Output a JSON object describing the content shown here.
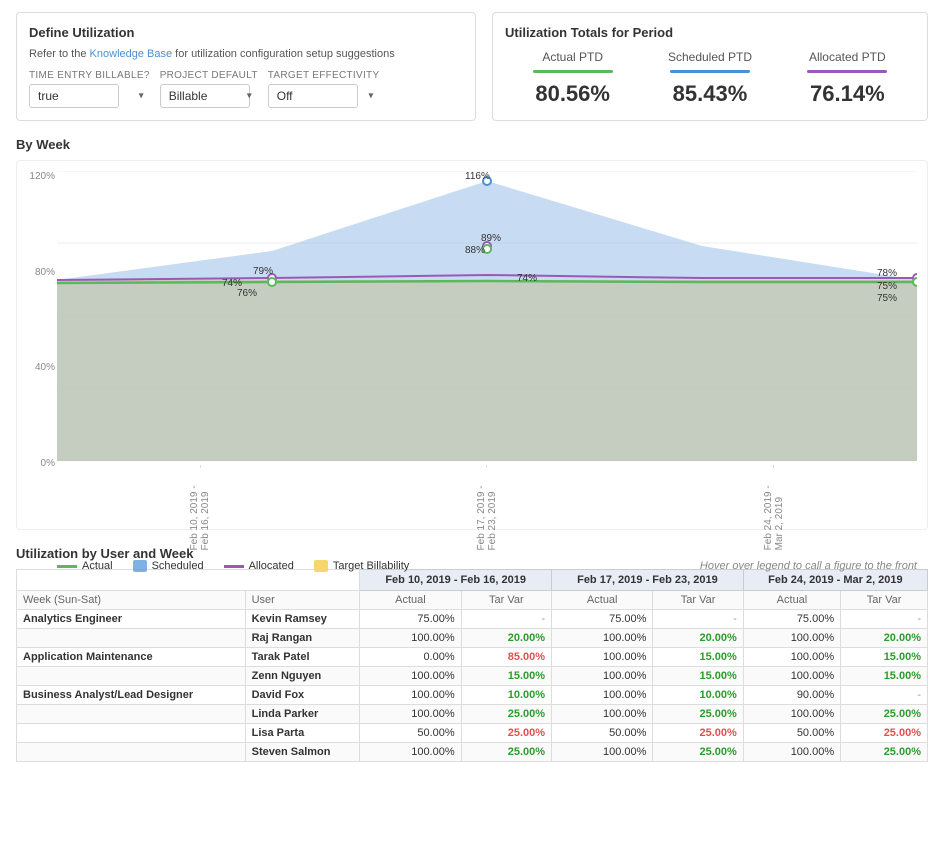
{
  "defineUtil": {
    "title": "Define Utilization",
    "note": "Refer to the",
    "noteLink": "Knowledge Base",
    "noteEnd": "for utilization configuration setup suggestions",
    "fields": {
      "timeEntryBillable": {
        "label": "TIME ENTRY BILLABLE?",
        "value": "true"
      },
      "projectDefault": {
        "label": "PROJECT DEFAULT",
        "value": "Billable"
      },
      "targetEffectivity": {
        "label": "TARGET EFFECTIVITY",
        "value": "Off"
      }
    }
  },
  "utilizationTotals": {
    "title": "Utilization Totals for Period",
    "items": [
      {
        "label": "Actual PTD",
        "value": "80.56%",
        "barClass": "green"
      },
      {
        "label": "Scheduled PTD",
        "value": "85.43%",
        "barClass": "blue"
      },
      {
        "label": "Allocated PTD",
        "value": "76.14%",
        "barClass": "purple"
      }
    ]
  },
  "byWeek": {
    "title": "By Week",
    "yLabels": [
      "120%",
      "80%",
      "40%",
      "0%"
    ],
    "xLabels": [
      "Feb 10, 2019 - Feb 16, 2019",
      "Feb 17, 2019 - Feb 23, 2019",
      "Feb 24, 2019 - Mar 2, 2019"
    ],
    "legend": [
      {
        "color": "#5cb85c",
        "label": "Actual",
        "type": "line"
      },
      {
        "color": "#4a90d9",
        "label": "Scheduled",
        "type": "area"
      },
      {
        "color": "#9b59b6",
        "label": "Allocated",
        "type": "line"
      },
      {
        "color": "#f5d76e",
        "label": "Target Billability",
        "type": "area"
      }
    ],
    "legendHint": "Hover over legend to call a figure to the front"
  },
  "userWeek": {
    "title": "Utilization by User and Week",
    "weekHeaders": [
      "Feb 10, 2019 - Feb 16, 2019",
      "Feb 17, 2019 - Feb 23, 2019",
      "Feb 24, 2019 - Mar 2, 2019"
    ],
    "subHeaders": [
      "Week (Sun-Sat)",
      "User",
      "Actual",
      "Tar Var",
      "Actual",
      "Tar Var",
      "Actual",
      "Tar Var"
    ],
    "rows": [
      {
        "role": "Analytics Engineer",
        "user": "Kevin Ramsey",
        "w1a": "75.00%",
        "w1t": "-",
        "w2a": "75.00%",
        "w2t": "-",
        "w3a": "75.00%",
        "w3t": "-",
        "w1tType": "dash",
        "w2tType": "dash",
        "w3tType": "dash"
      },
      {
        "role": "",
        "user": "Raj Rangan",
        "w1a": "100.00%",
        "w1t": "20.00%",
        "w2a": "100.00%",
        "w2t": "20.00%",
        "w3a": "100.00%",
        "w3t": "20.00%",
        "w1tType": "green",
        "w2tType": "green",
        "w3tType": "green"
      },
      {
        "role": "Application Maintenance",
        "user": "Tarak Patel",
        "w1a": "0.00%",
        "w1t": "85.00%",
        "w2a": "100.00%",
        "w2t": "15.00%",
        "w3a": "100.00%",
        "w3t": "15.00%",
        "w1tType": "red",
        "w2tType": "green",
        "w3tType": "green"
      },
      {
        "role": "",
        "user": "Zenn Nguyen",
        "w1a": "100.00%",
        "w1t": "15.00%",
        "w2a": "100.00%",
        "w2t": "15.00%",
        "w3a": "100.00%",
        "w3t": "15.00%",
        "w1tType": "green",
        "w2tType": "green",
        "w3tType": "green"
      },
      {
        "role": "Business Analyst/Lead Designer",
        "user": "David Fox",
        "w1a": "100.00%",
        "w1t": "10.00%",
        "w2a": "100.00%",
        "w2t": "10.00%",
        "w3a": "90.00%",
        "w3t": "-",
        "w1tType": "green",
        "w2tType": "green",
        "w3tType": "dash"
      },
      {
        "role": "",
        "user": "Linda Parker",
        "w1a": "100.00%",
        "w1t": "25.00%",
        "w2a": "100.00%",
        "w2t": "25.00%",
        "w3a": "100.00%",
        "w3t": "25.00%",
        "w1tType": "green",
        "w2tType": "green",
        "w3tType": "green"
      },
      {
        "role": "",
        "user": "Lisa Parta",
        "w1a": "50.00%",
        "w1t": "25.00%",
        "w2a": "50.00%",
        "w2t": "25.00%",
        "w3a": "50.00%",
        "w3t": "25.00%",
        "w1tType": "red",
        "w2tType": "red",
        "w3tType": "red"
      },
      {
        "role": "",
        "user": "Steven Salmon",
        "w1a": "100.00%",
        "w1t": "25.00%",
        "w2a": "100.00%",
        "w2t": "25.00%",
        "w3a": "100.00%",
        "w3t": "25.00%",
        "w1tType": "green",
        "w2tType": "green",
        "w3tType": "green"
      }
    ]
  }
}
